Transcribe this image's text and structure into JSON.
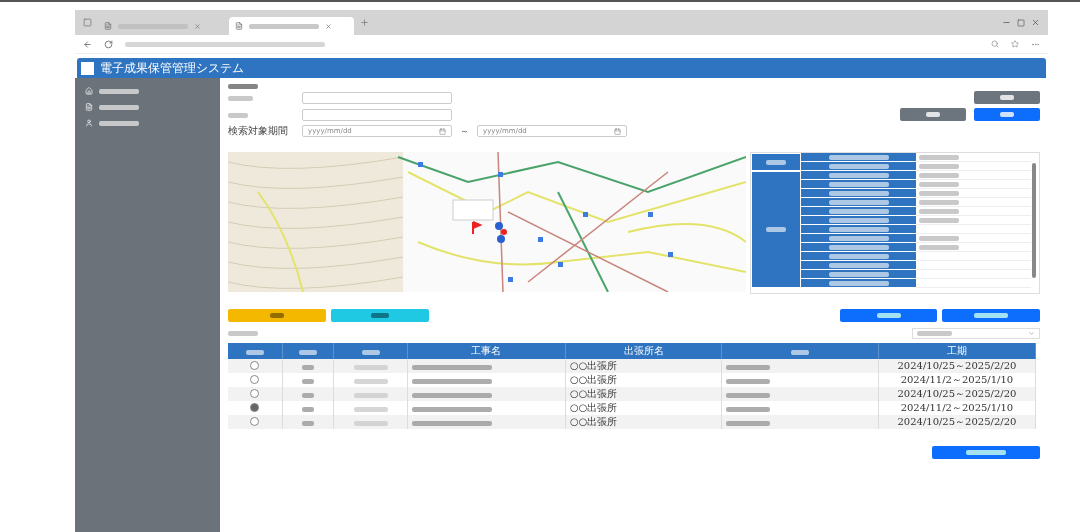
{
  "app": {
    "title": "電子成果保管管理システム"
  },
  "browser": {
    "tabs": [
      {
        "selected": false
      },
      {
        "selected": true
      }
    ]
  },
  "sidebar": {
    "items": [
      {
        "kind": "home"
      },
      {
        "kind": "doc"
      },
      {
        "kind": "user"
      }
    ]
  },
  "search": {
    "period_label": "検索対象期間",
    "from_placeholder": "yyyy/mm/dd",
    "separator": "～",
    "to_placeholder": "yyyy/mm/dd"
  },
  "info_panel": {
    "groups": [
      {
        "rows": [
          {
            "filled": true
          },
          {
            "filled": true
          }
        ]
      },
      {
        "rows": [
          {
            "filled": true
          },
          {
            "filled": true
          },
          {
            "filled": true
          },
          {
            "filled": true
          },
          {
            "filled": true
          },
          {
            "filled": true
          },
          {
            "filled": false
          },
          {
            "filled": true
          },
          {
            "filled": true
          },
          {
            "filled": false
          },
          {
            "filled": false
          },
          {
            "filled": false
          },
          {
            "filled": false
          }
        ]
      }
    ]
  },
  "table": {
    "columns": [
      {},
      {},
      {},
      {
        "label": "工事名"
      },
      {
        "label": "出張所名"
      },
      {},
      {
        "label": "工期"
      }
    ],
    "rows": [
      {
        "selected": false,
        "office": "○○出張所",
        "period": "2024/10/25～2025/2/20"
      },
      {
        "selected": false,
        "office": "○○出張所",
        "period": "2024/11/2～2025/1/10"
      },
      {
        "selected": false,
        "office": "○○出張所",
        "period": "2024/10/25～2025/2/20"
      },
      {
        "selected": true,
        "office": "○○出張所",
        "period": "2024/11/2～2025/1/10"
      },
      {
        "selected": false,
        "office": "○○出張所",
        "period": "2024/10/25～2025/2/20"
      }
    ]
  }
}
